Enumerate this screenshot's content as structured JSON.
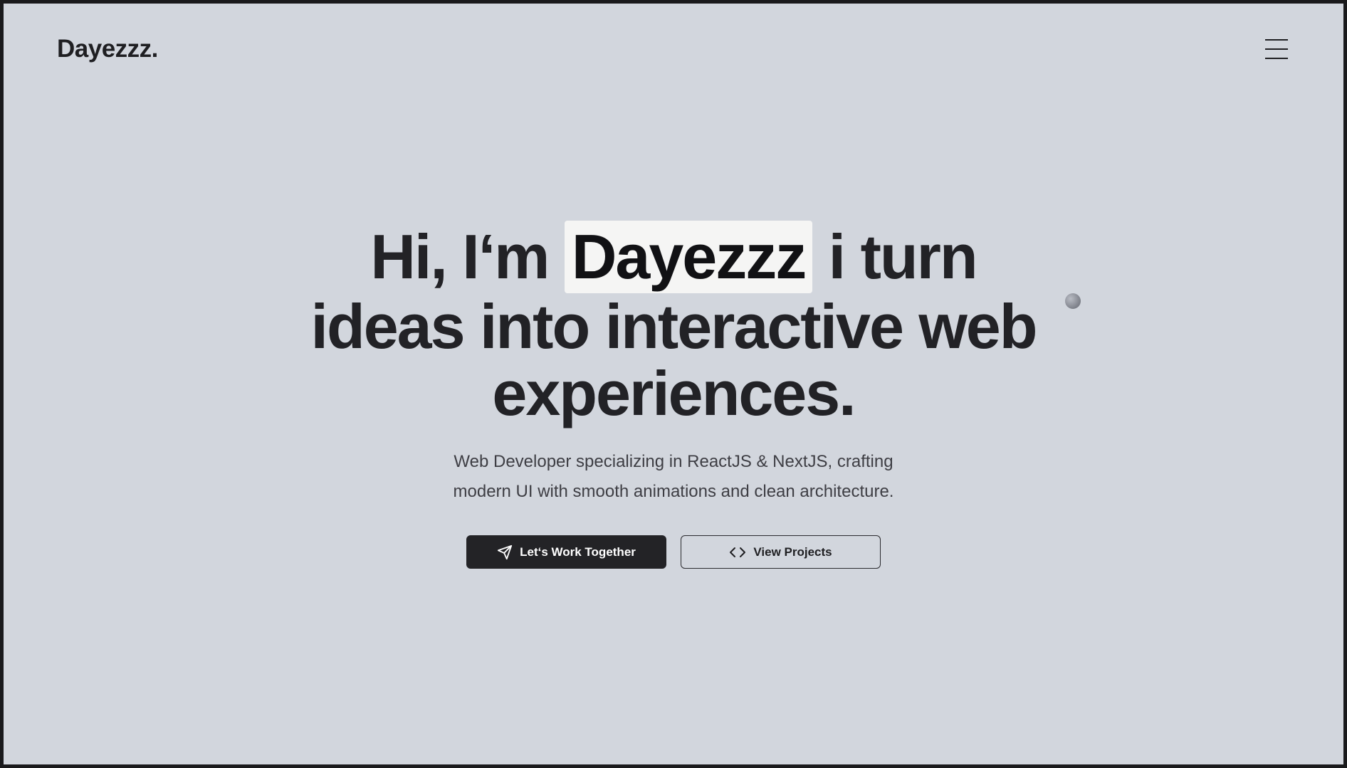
{
  "header": {
    "logo": "Dayezzz.",
    "menu_icon": "hamburger-menu-icon"
  },
  "hero": {
    "headline_pre": "Hi, I‘m ",
    "headline_name": "Dayezzz",
    "headline_post_line1": " i turn",
    "headline_line2": "ideas into interactive web",
    "headline_line3": "experiences.",
    "subtitle_line1": "Web Developer specializing in ReactJS & NextJS, crafting",
    "subtitle_line2": "modern UI with smooth animations and clean architecture.",
    "primary_button": {
      "label": "Let‘s Work Together",
      "icon": "send-icon"
    },
    "secondary_button": {
      "label": "View Projects",
      "icon": "code-icon"
    }
  },
  "colors": {
    "background": "#d2d6dd",
    "text": "#222226",
    "name_highlight": "#f5f5f4",
    "primary_button": "#232326"
  }
}
